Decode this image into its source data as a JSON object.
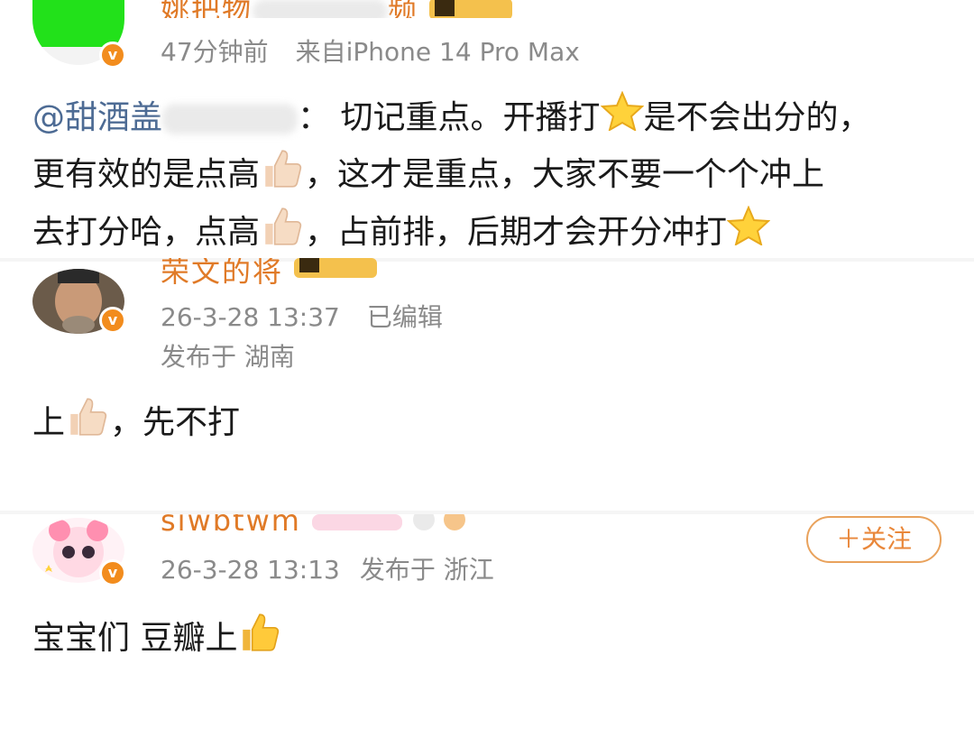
{
  "post1": {
    "username_visible": "姚把物",
    "username_hidden_suffix": "频",
    "time": "47分钟前",
    "source": "来自iPhone 14 Pro Max",
    "mention": "@甜酒盖",
    "mention_tail": "：",
    "text_line1": "切记重点。开播打",
    "text_line1b": "是不会出分的，",
    "text_line2a": "更有效的是点高",
    "text_line2b": "，这才是重点，大家不要一个个冲上",
    "text_line3a": "去打分哈，点高",
    "text_line3b": "，占前排，后期才会开分冲打"
  },
  "post2": {
    "username": "荣文的将",
    "time": "26-3-28 13:37",
    "edited": "已编辑",
    "location": "发布于 湖南",
    "text_a": "上",
    "text_b": "，先不打"
  },
  "post3": {
    "username": "siwbtwm",
    "time": "26-3-28 13:13",
    "location": "发布于 浙江",
    "follow_label": "＋关注",
    "text": "宝宝们 豆瓣上"
  },
  "colors": {
    "username": "#e07a27",
    "mention": "#4d6b94",
    "meta": "#8a8a8a",
    "verified_badge": "#f28c1d",
    "follow_border": "#e9a25c"
  }
}
